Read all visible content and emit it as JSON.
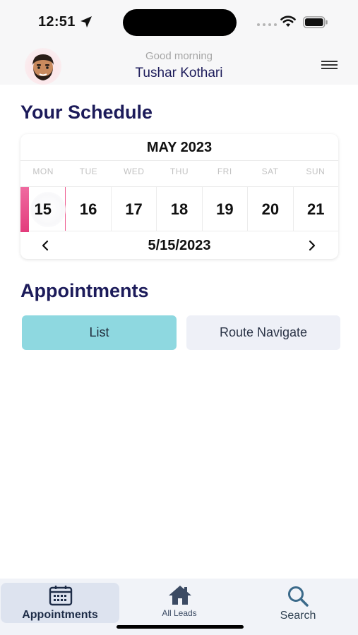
{
  "status_bar": {
    "time": "12:51"
  },
  "header": {
    "greeting": "Good morning",
    "user_name": "Tushar Kothari"
  },
  "schedule": {
    "title": "Your Schedule",
    "month": "MAY 2023",
    "weekdays": [
      "MON",
      "TUE",
      "WED",
      "THU",
      "FRI",
      "SAT",
      "SUN"
    ],
    "dates": [
      "15",
      "16",
      "17",
      "18",
      "19",
      "20",
      "21"
    ],
    "selected_index": 0,
    "selected_date": "5/15/2023"
  },
  "appointments": {
    "title": "Appointments",
    "list_label": "List",
    "route_label": "Route Navigate"
  },
  "bottom_nav": {
    "items": [
      {
        "label": "Appointments",
        "icon": "calendar-icon",
        "active": true
      },
      {
        "label": "All Leads",
        "icon": "home-icon",
        "active": false
      },
      {
        "label": "Search",
        "icon": "search-icon",
        "active": false
      }
    ]
  },
  "colors": {
    "primary_text": "#1c1b5a",
    "accent_pink": "#e33c7c",
    "list_button": "#8ed8e0",
    "route_button": "#eef0f7"
  }
}
